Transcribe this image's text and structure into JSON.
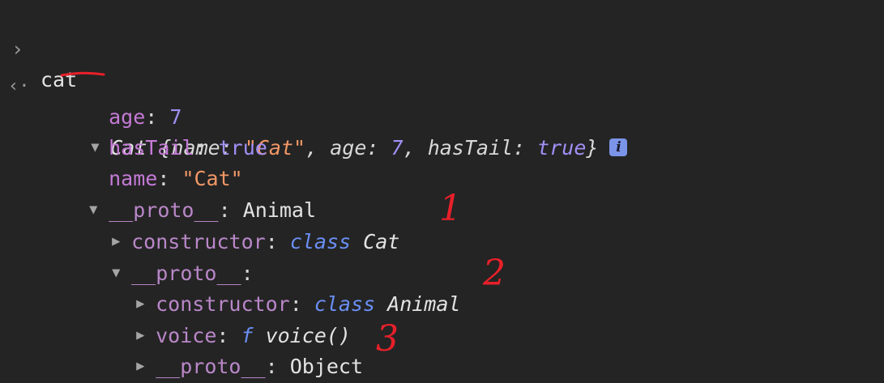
{
  "console": {
    "input_prompt": "›",
    "output_prompt": "‹·",
    "command": "cat",
    "summary": {
      "class_name": "Cat",
      "open": " {",
      "k1": "name",
      "v1": "\"Cat\"",
      "k2": "age",
      "v2": "7",
      "k3": "hasTail",
      "v3": "true",
      "close": "}",
      "info_badge": "i"
    },
    "props": {
      "age_key": "age",
      "age_val": "7",
      "hasTail_key": "hasTail",
      "hasTail_val": "true",
      "name_key": "name",
      "name_val": "\"Cat\""
    },
    "proto1": {
      "key": "__proto__",
      "val": "Animal",
      "constructor_key": "constructor",
      "constructor_kw": "class",
      "constructor_name": "Cat"
    },
    "proto2": {
      "key": "__proto__",
      "constructor_key": "constructor",
      "constructor_kw": "class",
      "constructor_name": "Animal",
      "voice_key": "voice",
      "voice_kw": "f",
      "voice_sig": "voice()",
      "proto_key": "__proto__",
      "proto_val": "Object"
    },
    "colon": ":",
    "comma": ","
  },
  "annotations": {
    "one": "1",
    "two": "2",
    "three": "3"
  },
  "colors": {
    "background": "#242424",
    "key": "#c47ad6",
    "number": "#a18ff5",
    "string": "#f29766",
    "keyword": "#6a8ff5",
    "annotation": "#e8202a"
  }
}
